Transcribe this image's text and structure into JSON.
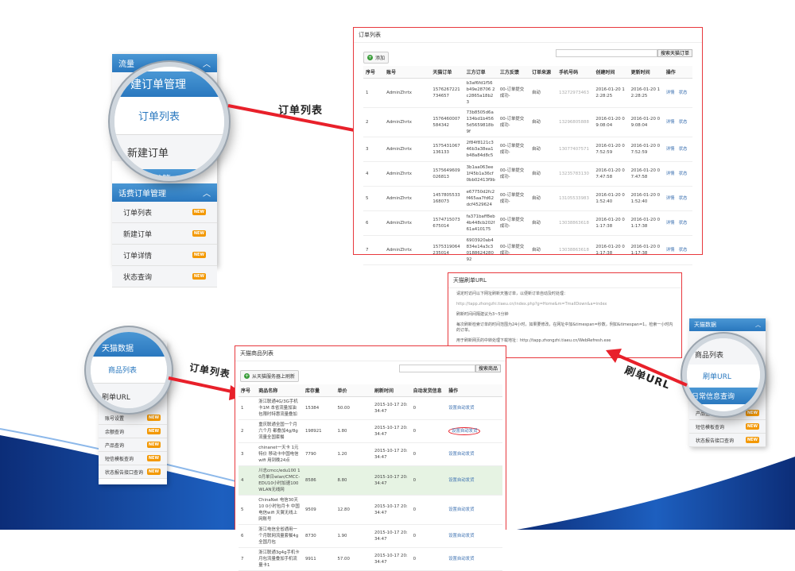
{
  "colors": {
    "accent_red": "#e8383d",
    "sidebar_blue": "#2a78bf",
    "new_badge": "#f39800",
    "wave_blue": "#1a4fa0"
  },
  "annotations": {
    "order_list": "订单列表",
    "order_list_2": "订单列表",
    "refresh_url": "刷单URL"
  },
  "sidebar1": {
    "top_label": "流量",
    "lens_items": [
      "建订单管理",
      "订单列表",
      "新建订单",
      "话费订单管"
    ],
    "section": "话费订单管理",
    "items": [
      {
        "label": "订单列表",
        "badge": "NEW"
      },
      {
        "label": "新建订单",
        "badge": "NEW"
      },
      {
        "label": "订单详情",
        "badge": "NEW"
      },
      {
        "label": "状态查询",
        "badge": "NEW"
      }
    ]
  },
  "orders": {
    "title": "订单列表",
    "add_button": "添加",
    "search_button": "搜索天猫订单",
    "columns": [
      "序号",
      "账号",
      "天猫订单",
      "三方订单",
      "三方反馈",
      "订单来源",
      "手机号码",
      "创建时间",
      "更新时间",
      "操作"
    ],
    "rows": [
      [
        "1",
        "AdminZhrtx",
        "1576267221734657",
        "b3af6fd1f56b49e28706 2c2865a18b23",
        "00-订单提交成功-",
        "自动",
        "13272973463",
        "2016-01-20 12:28:25",
        "2016-01-20 12:28:25",
        "详情",
        "状态"
      ],
      [
        "2",
        "AdminZhrtx",
        "1576460007584342",
        "73b8505d6a134bd1b4565d5659818b9f",
        "00-订单提交成功-",
        "自动",
        "13296805888",
        "2016-01-20 09:08:04",
        "2016-01-20 09:08:04",
        "详情",
        "状态"
      ],
      [
        "3",
        "AdminZhrtx",
        "1575431067136133",
        "2f84f8121c346b3a38ea1b48a84d8c5",
        "00-订单提交成功-",
        "自动",
        "13077407571",
        "2016-01-20 07:52:59",
        "2016-01-20 07:52:59",
        "详情",
        "状态"
      ],
      [
        "4",
        "AdminZhrtx",
        "1575649609026813",
        "3b1aa063ee1f45b1a36cf0bb02413f9b",
        "00-订单提交成功-",
        "自动",
        "13235783130",
        "2016-01-20 07:47:58",
        "2016-01-20 07:47:58",
        "详情",
        "状态"
      ],
      [
        "5",
        "AdminZhrtx",
        "1457805533168073",
        "e67750d2fc2f465aa7fd62dcf4529624",
        "00-订单提交成功-",
        "自动",
        "13105533983",
        "2016-01-20 01:52:40",
        "2016-01-20 01:52:40",
        "详情",
        "状态"
      ],
      [
        "6",
        "AdminZhrtx",
        "1574715073675014",
        "fa371baff8eb4b448cb202f61a410175",
        "00-订单提交成功-",
        "自动",
        "13038863618",
        "2016-01-20 01:17:38",
        "2016-01-20 01:17:38",
        "详情",
        "状态"
      ],
      [
        "7",
        "AdminZhrtx",
        "1575319064235014",
        "6903920ab4834e14a3c3018862428092",
        "00-订单提交成功-",
        "自动",
        "13038863618",
        "2016-01-20 01:17:38",
        "2016-01-20 01:17:38",
        "详情",
        "状态"
      ]
    ]
  },
  "refresh": {
    "title": "天猫刷单URL",
    "lines": [
      "请定时访问以下网址刷新天猫订单，以便新订单自动及时处理：",
      "http://tapp.zhongzhi.tiaeu.cn/index.php?g=Home&m=TmallDown&a=index",
      "刷新时间间隔建议为3~5分钟",
      "每次刷新检索订单的时间范围为24小时，如果要修改，在网址中加&timespan=秒数，例如&timespan=1，检索一小时内的订单。",
      "用于刷新网页的中转处理下载地址：http://tapp.zhongzhi.tiaeu.cn/WebRefresh.exe"
    ]
  },
  "sidebar2": {
    "section": "天猫数据",
    "lens_items": [
      "商品列表",
      "刷单URL",
      "日常信息查询"
    ],
    "items": [
      {
        "label": "产品查询",
        "badge": "NEW"
      },
      {
        "label": "短信模板查询",
        "badge": "NEW"
      },
      {
        "label": "状态报告接口查询",
        "badge": "NEW"
      }
    ]
  },
  "sidebar3": {
    "lens_items": [
      "天猫数据",
      "商品列表",
      "刷单URL"
    ],
    "items": [
      {
        "label": "账号设置",
        "badge": "NEW"
      },
      {
        "label": "余额查询",
        "badge": "NEW"
      },
      {
        "label": "产品查询",
        "badge": "NEW"
      },
      {
        "label": "短信模板查询",
        "badge": "NEW"
      },
      {
        "label": "状态报告接口查询",
        "badge": "NEW"
      }
    ]
  },
  "goods": {
    "title": "天猫商品列表",
    "add_button": "从天猫服务器上刷新",
    "search_button": "搜索商品",
    "columns": [
      "序号",
      "商品名称",
      "库存量",
      "单价",
      "刷新时间",
      "自动发货信息",
      "操作"
    ],
    "rows": [
      [
        "1",
        "浙江联通4G/3G手机卡1M 本省流量加油包限时特惠流量叠加",
        "15384",
        "50.00",
        "2015-10-17 20:34:47",
        "0",
        "设置自动发货"
      ],
      [
        "2",
        "重庆联通全国一个月六个月 都叠加4g/8g流量全国套餐",
        "198921",
        "1.80",
        "2015-10-17 20:34:47",
        "0",
        "设置自动发货"
      ],
      [
        "3",
        "chinanet一天卡 1元特价 移动卡中国电信wifi 用到晚24点",
        "7790",
        "1.20",
        "2015-10-17 20:34:47",
        "0",
        "设置自动发货"
      ],
      [
        "4",
        "川志cmcc/edu100 10月单日wlan/CMCC-EDU10小时加速100 WLAN无线网",
        "8586",
        "8.80",
        "2015-10-17 20:34:47",
        "0",
        "设置自动发货"
      ],
      [
        "5",
        "ChinaNet 电信30天 10 0小时包月卡 中国电信wifi 天翼无线上网账号",
        "9509",
        "12.80",
        "2015-10-17 20:34:47",
        "0",
        "设置自动发货"
      ],
      [
        "6",
        "浙江电信全省通用一个月联网流量套餐4g全国月包",
        "8730",
        "1.90",
        "2015-10-17 20:34:47",
        "0",
        "设置自动发货"
      ],
      [
        "7",
        "浙江联通3g4g手机卡月包流量叠加手机流量卡1",
        "9911",
        "57.00",
        "2015-10-17 20:34:47",
        "0",
        "设置自动发货"
      ]
    ]
  }
}
